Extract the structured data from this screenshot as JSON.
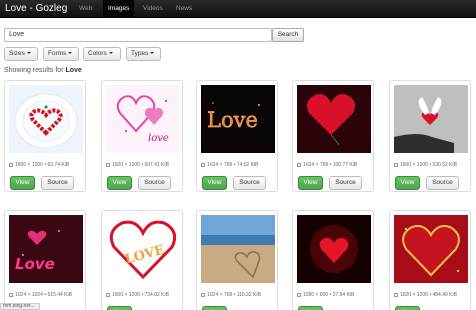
{
  "app": {
    "brand": "Love - Gozleg",
    "nav": [
      "Web",
      "Images",
      "Videos",
      "News"
    ],
    "active_nav": "Images"
  },
  "search": {
    "value": "Love",
    "button": "Search"
  },
  "filters": [
    "Sizes",
    "Forms",
    "Colors",
    "Types"
  ],
  "results": {
    "prefix": "Showing results for ",
    "query": "Love"
  },
  "cards": [
    {
      "image": "heart-of-roses-on-plate",
      "meta": "1600 × 1200 • 63.74 KiB"
    },
    {
      "image": "pink-hearts-love-script",
      "meta": "1920 × 1200 • 607.41 KiB"
    },
    {
      "image": "neon-love-text",
      "meta": "1024 × 768 • 74.02 KiB"
    },
    {
      "image": "red-heart-balloon-figure",
      "meta": "1024 × 768 • 100.77 KiB"
    },
    {
      "image": "hand-holding-heart-with-wings",
      "meta": "1600 × 1200 • 530.52 KiB"
    },
    {
      "image": "pink-love-sparkles",
      "meta": "1024 × 1024 • 615.44 KiB"
    },
    {
      "image": "love-letters-in-heart",
      "meta": "1600 × 1200 • 734.02 KiB"
    },
    {
      "image": "heart-drawn-in-sand",
      "meta": "1024 × 768 • 110.32 KiB"
    },
    {
      "image": "glowing-red-heart",
      "meta": "1280 × 800 • 27.94 KiB"
    },
    {
      "image": "gold-heart-on-red",
      "meta": "1920 × 1200 • 484.40 KiB"
    }
  ],
  "buttons": {
    "view": "View",
    "source": "Source"
  },
  "status": "mm.bing.net..."
}
